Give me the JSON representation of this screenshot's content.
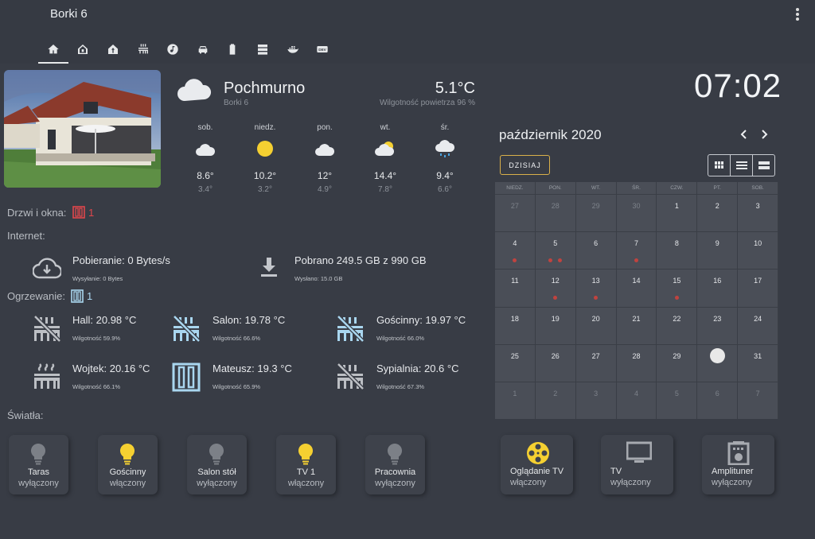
{
  "header": {
    "title": "Borki 6",
    "tabs": [
      "home-icon",
      "house-outline-icon",
      "house-up-icon",
      "radiator-icon",
      "music-icon",
      "car-icon",
      "battery-icon",
      "server-icon",
      "docker-icon",
      "dev-icon"
    ],
    "dev_label": "DEV"
  },
  "weather": {
    "condition": "Pochmurno",
    "location": "Borki 6",
    "temperature": "5.1°C",
    "humidity": "Wilgotność powietrza 96 %",
    "forecast": [
      {
        "day": "sob.",
        "icon": "cloudy-icon",
        "high": "8.6°",
        "low": "3.4°"
      },
      {
        "day": "niedz.",
        "icon": "sun-icon",
        "high": "10.2°",
        "low": "3.2°"
      },
      {
        "day": "pon.",
        "icon": "cloudy-icon",
        "high": "12°",
        "low": "4.9°"
      },
      {
        "day": "wt.",
        "icon": "partly-cloudy-icon",
        "high": "14.4°",
        "low": "7.8°"
      },
      {
        "day": "śr.",
        "icon": "rain-icon",
        "high": "9.4°",
        "low": "6.6°"
      }
    ]
  },
  "doors": {
    "label": "Drzwi i okna:",
    "count": "1",
    "color": "#e0474c"
  },
  "internet": {
    "label": "Internet:",
    "download": "Pobieranie: 0 Bytes/s",
    "upload": "Wysyłanie: 0 Bytes",
    "downloaded": "Pobrano 249.5 GB z 990 GB",
    "uploaded": "Wysłano: 15.0 GB"
  },
  "heating": {
    "label": "Ogrzewanie:",
    "count": "1",
    "rooms": [
      {
        "name": "Hall: 20.98 °C",
        "humidity": "Wilgotność 59.9%",
        "icon": "heating-off-icon"
      },
      {
        "name": "Salon: 19.78 °C",
        "humidity": "Wilgotność 66.6%",
        "icon": "heating-off-icon"
      },
      {
        "name": "Gościnny: 19.97 °C",
        "humidity": "Wilgotność 66.0%",
        "icon": "heating-off-icon"
      },
      {
        "name": "Wojtek: 20.16 °C",
        "humidity": "Wilgotność 66.1%",
        "icon": "radiator-icon"
      },
      {
        "name": "Mateusz: 19.3 °C",
        "humidity": "Wilgotność 65.9%",
        "icon": "window-open-icon"
      },
      {
        "name": "Sypialnia: 20.6 °C",
        "humidity": "Wilgotność 67.3%",
        "icon": "heating-off-icon"
      }
    ]
  },
  "lights": {
    "label": "Światła:",
    "items": [
      {
        "name": "Taras",
        "state": "wyłączony",
        "on": false
      },
      {
        "name": "Gościnny",
        "state": "włączony",
        "on": true
      },
      {
        "name": "Salon stół",
        "state": "wyłączony",
        "on": false
      },
      {
        "name": "TV 1",
        "state": "włączony",
        "on": true
      },
      {
        "name": "Pracownia",
        "state": "wyłączony",
        "on": false
      }
    ]
  },
  "scenes": [
    {
      "name": "Oglądanie TV",
      "state": "włączony",
      "icon": "film-reel-icon"
    },
    {
      "name": "TV",
      "state": "wyłączony",
      "icon": "tv-icon"
    },
    {
      "name": "Amplituner",
      "state": "wyłączony",
      "icon": "amplifier-icon"
    }
  ],
  "clock": "07:02",
  "calendar": {
    "title": "październik 2020",
    "today_label": "DZISIAJ",
    "weekdays": [
      "NIEDZ.",
      "PON.",
      "WT.",
      "ŚR.",
      "CZW.",
      "PT.",
      "SOB."
    ],
    "days": [
      {
        "n": "27",
        "out": true,
        "dots": 0
      },
      {
        "n": "28",
        "out": true,
        "dots": 0
      },
      {
        "n": "29",
        "out": true,
        "dots": 0
      },
      {
        "n": "30",
        "out": true,
        "dots": 0
      },
      {
        "n": "1",
        "out": false,
        "dots": 0
      },
      {
        "n": "2",
        "out": false,
        "dots": 0
      },
      {
        "n": "3",
        "out": false,
        "dots": 0
      },
      {
        "n": "4",
        "out": false,
        "dots": 1
      },
      {
        "n": "5",
        "out": false,
        "dots": 2
      },
      {
        "n": "6",
        "out": false,
        "dots": 0
      },
      {
        "n": "7",
        "out": false,
        "dots": 1
      },
      {
        "n": "8",
        "out": false,
        "dots": 0
      },
      {
        "n": "9",
        "out": false,
        "dots": 0
      },
      {
        "n": "10",
        "out": false,
        "dots": 0
      },
      {
        "n": "11",
        "out": false,
        "dots": 0
      },
      {
        "n": "12",
        "out": false,
        "dots": 1
      },
      {
        "n": "13",
        "out": false,
        "dots": 1
      },
      {
        "n": "14",
        "out": false,
        "dots": 0
      },
      {
        "n": "15",
        "out": false,
        "dots": 1
      },
      {
        "n": "16",
        "out": false,
        "dots": 0
      },
      {
        "n": "17",
        "out": false,
        "dots": 0
      },
      {
        "n": "18",
        "out": false,
        "dots": 0
      },
      {
        "n": "19",
        "out": false,
        "dots": 0
      },
      {
        "n": "20",
        "out": false,
        "dots": 0
      },
      {
        "n": "21",
        "out": false,
        "dots": 0
      },
      {
        "n": "22",
        "out": false,
        "dots": 0
      },
      {
        "n": "23",
        "out": false,
        "dots": 0
      },
      {
        "n": "24",
        "out": false,
        "dots": 0
      },
      {
        "n": "25",
        "out": false,
        "dots": 0
      },
      {
        "n": "26",
        "out": false,
        "dots": 0
      },
      {
        "n": "27",
        "out": false,
        "dots": 0
      },
      {
        "n": "28",
        "out": false,
        "dots": 0
      },
      {
        "n": "29",
        "out": false,
        "dots": 0
      },
      {
        "n": "30",
        "out": false,
        "dots": 0,
        "today": true
      },
      {
        "n": "31",
        "out": false,
        "dots": 0
      },
      {
        "n": "1",
        "out": true,
        "dots": 0
      },
      {
        "n": "2",
        "out": true,
        "dots": 0
      },
      {
        "n": "3",
        "out": true,
        "dots": 0
      },
      {
        "n": "4",
        "out": true,
        "dots": 0
      },
      {
        "n": "5",
        "out": true,
        "dots": 0
      },
      {
        "n": "6",
        "out": true,
        "dots": 0
      },
      {
        "n": "7",
        "out": true,
        "dots": 0
      }
    ]
  },
  "colors": {
    "accent_yellow": "#f5d031",
    "icon_blue": "#a9d6ef",
    "icon_gray": "#bcbfc4",
    "alert_red": "#e0474c",
    "event_dot": "#c0433f"
  }
}
